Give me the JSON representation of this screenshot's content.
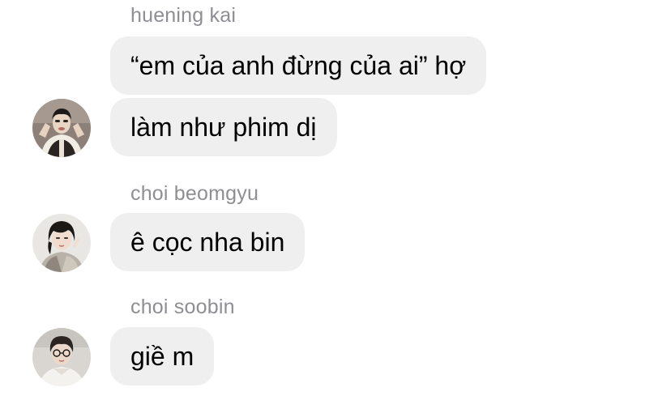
{
  "chat": {
    "groups": [
      {
        "sender": "huening kai",
        "avatar_icon": "profile-photo-avatar",
        "messages": [
          "“em của anh đừng của ai” hợ",
          "làm như phim dị"
        ]
      },
      {
        "sender": "choi beomgyu",
        "avatar_icon": "profile-photo-avatar",
        "messages": [
          "ê cọc nha bin"
        ]
      },
      {
        "sender": "choi soobin",
        "avatar_icon": "profile-photo-avatar",
        "messages": [
          "giề m"
        ]
      }
    ]
  },
  "colors": {
    "bubble_background": "#efeff0",
    "sender_name": "#8e8e93",
    "message_text": "#000000"
  }
}
